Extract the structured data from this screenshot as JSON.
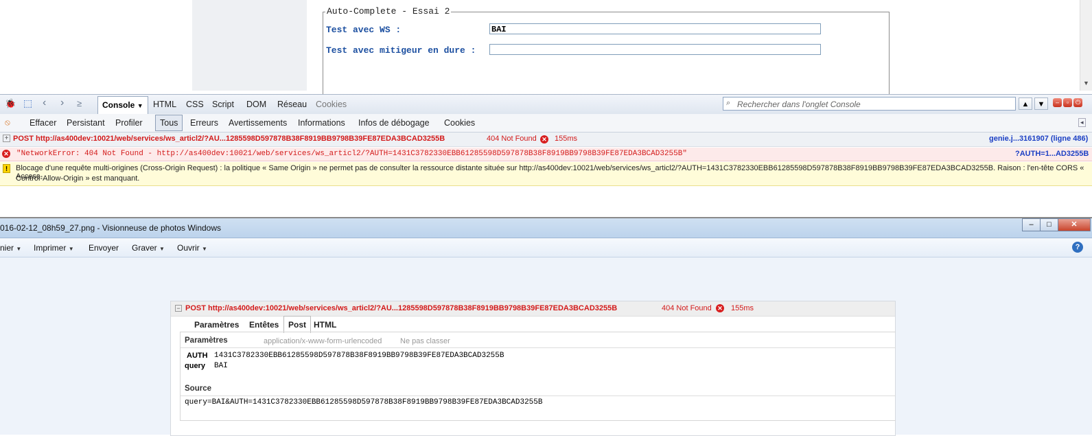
{
  "webpage": {
    "legend": "Auto-Complete - Essai 2",
    "field1_label": "Test avec WS :",
    "field1_value": "BAI",
    "field2_label": "Test avec mitigeur en dure :",
    "field2_value": ""
  },
  "firebug": {
    "tabs": [
      "Console",
      "HTML",
      "CSS",
      "Script",
      "DOM",
      "Réseau",
      "Cookies"
    ],
    "search_placeholder": "Rechercher dans l'onglet Console",
    "filters": [
      "Effacer",
      "Persistant",
      "Profiler",
      "Tous",
      "Erreurs",
      "Avertissements",
      "Informations",
      "Infos de débogage",
      "Cookies"
    ],
    "request_row": {
      "method_url": "POST http://as400dev:10021/web/services/ws_articl2/?AU...1285598D597878B38F8919BB9798B39FE87EDA3BCAD3255B",
      "status": "404 Not Found",
      "time": "155ms",
      "source": "genie.j...3161907 (ligne 486)"
    },
    "error_row": {
      "message": "\"NetworkError: 404 Not Found - http://as400dev:10021/web/services/ws_articl2/?AUTH=1431C3782330EBB61285598D597878B38F8919BB9798B39FE87EDA3BCAD3255B\"",
      "source": "?AUTH=1...AD3255B"
    },
    "warning_row": {
      "line1": "Blocage d'une requête multi-origines (Cross-Origin Request) : la politique « Same Origin » ne permet pas de consulter la ressource distante située sur http://as400dev:10021/web/services/ws_articl2/?AUTH=1431C3782330EBB61285598D597878B38F8919BB9798B39FE87EDA3BCAD3255B. Raison : l'en-tête CORS « Access-",
      "line2": "Control-Allow-Origin » est manquant."
    }
  },
  "photo_viewer": {
    "title": "016-02-12_08h59_27.png - Visionneuse de photos Windows",
    "menu": [
      "nier",
      "Imprimer",
      "Envoyer",
      "Graver",
      "Ouvrir"
    ]
  },
  "inner": {
    "request": "POST http://as400dev:10021/web/services/ws_articl2/?AU...1285598D597878B38F8919BB9798B39FE87EDA3BCAD3255B",
    "status": "404 Not Found",
    "time": "155ms",
    "tabs": [
      "Paramètres",
      "Entêtes",
      "Post",
      "HTML"
    ],
    "params_header": "Paramètres",
    "params_type": "application/x-www-form-urlencoded",
    "params_sort": "Ne pas classer",
    "params": [
      {
        "key": "AUTH",
        "value": "1431C3782330EBB61285598D597878B38F8919BB9798B39FE87EDA3BCAD3255B"
      },
      {
        "key": "query",
        "value": "BAI"
      }
    ],
    "source_header": "Source",
    "source_value": "query=BAI&AUTH=1431C3782330EBB61285598D597878B38F8919BB9798B39FE87EDA3BCAD3255B"
  }
}
